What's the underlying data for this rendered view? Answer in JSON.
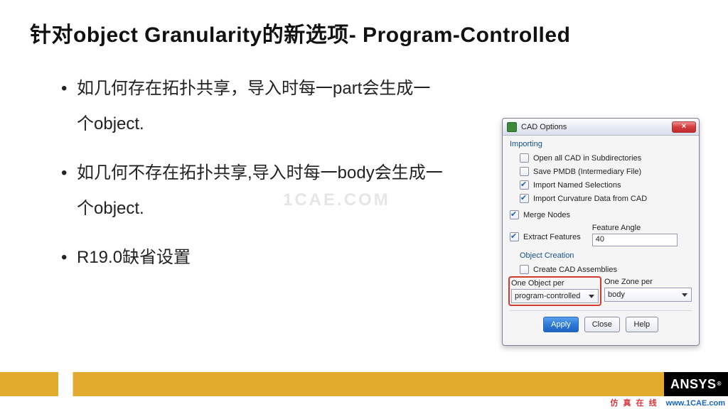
{
  "slide": {
    "title": "针对object Granularity的新选项- Program-Controlled",
    "bullets": [
      "如几何存在拓扑共享，导入时每一part会生成一个object.",
      "如几何不存在拓扑共享,导入时每一body会生成一个object.",
      "R19.0缺省设置"
    ],
    "watermark": "1CAE.COM"
  },
  "dialog": {
    "title": "CAD Options",
    "close": "×",
    "groups": {
      "importing": {
        "label": "Importing",
        "items": {
          "open_all": {
            "label": "Open all CAD in Subdirectories",
            "checked": false
          },
          "save_pmdb": {
            "label": "Save PMDB (Intermediary File)",
            "checked": false
          },
          "named_sel": {
            "label": "Import Named Selections",
            "checked": true
          },
          "curvature": {
            "label": "Import Curvature Data from CAD",
            "checked": true
          }
        }
      },
      "merge_nodes": {
        "label": "Merge Nodes",
        "checked": true
      },
      "extract_features": {
        "checked": true,
        "label": "Extract Features",
        "angle_label": "Feature Angle",
        "angle_value": "40"
      },
      "object_creation": {
        "label": "Object Creation",
        "create_asm": {
          "label": "Create CAD Assemblies",
          "checked": false
        },
        "one_object": {
          "label": "One Object per",
          "value": "program-controlled"
        },
        "one_zone": {
          "label": "One Zone per",
          "value": "body"
        }
      }
    },
    "buttons": {
      "apply": "Apply",
      "close": "Close",
      "help": "Help"
    }
  },
  "footer": {
    "brand": "ANSYS",
    "zh": "仿 真 在 线",
    "url": "www.1CAE.com"
  }
}
